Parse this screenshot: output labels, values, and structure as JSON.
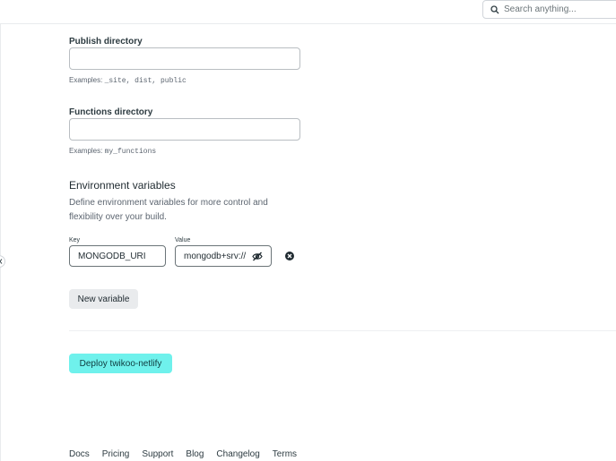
{
  "header": {
    "search": {
      "placeholder": "Search anything..."
    }
  },
  "form": {
    "publish_directory": {
      "label": "Publish directory",
      "value": "",
      "hint_prefix": "Examples: ",
      "hint_code": "_site, dist, public"
    },
    "functions_directory": {
      "label": "Functions directory",
      "value": "",
      "hint_prefix": "Examples: ",
      "hint_code": "my_functions"
    },
    "environment": {
      "title": "Environment variables",
      "description": "Define environment variables for more control and flexibility over your build.",
      "key_label": "Key",
      "value_label": "Value",
      "variables": [
        {
          "key": "MONGODB_URI",
          "value": "mongodb+srv://"
        }
      ],
      "new_variable_label": "New variable"
    },
    "deploy_label": "Deploy twikoo-netlify"
  },
  "footer": {
    "links": [
      "Docs",
      "Pricing",
      "Support",
      "Blog",
      "Changelog",
      "Terms"
    ]
  },
  "colors": {
    "primary_button": "#6ff1ec",
    "secondary_button": "#e9ebed",
    "text": "#2d3b41"
  },
  "icons": {
    "search": "search-icon",
    "collapse": "chevron-left-icon",
    "visibility": "eye-off-icon",
    "remove": "close-circle-icon"
  }
}
